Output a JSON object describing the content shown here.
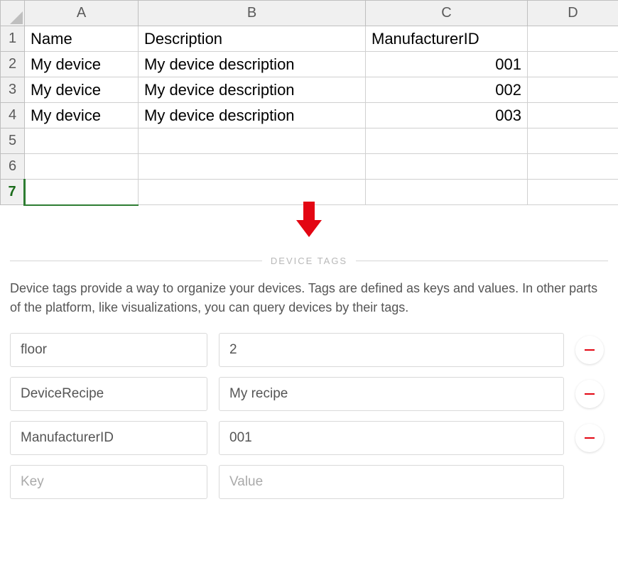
{
  "spreadsheet": {
    "columns": [
      "A",
      "B",
      "C",
      "D"
    ],
    "rows": [
      "1",
      "2",
      "3",
      "4",
      "5",
      "6",
      "7"
    ],
    "selected_row": "7",
    "data": [
      {
        "A": "Name",
        "B": "Description",
        "C": "ManufacturerID",
        "C_align": "left",
        "D": ""
      },
      {
        "A": "My device",
        "B": "My device description",
        "C": "001",
        "C_align": "right",
        "D": ""
      },
      {
        "A": "My device",
        "B": "My device description",
        "C": "002",
        "C_align": "right",
        "D": ""
      },
      {
        "A": "My device",
        "B": "My device description",
        "C": "003",
        "C_align": "right",
        "D": ""
      },
      {
        "A": "",
        "B": "",
        "C": "",
        "D": ""
      },
      {
        "A": "",
        "B": "",
        "C": "",
        "D": ""
      },
      {
        "A": "",
        "B": "",
        "C": "",
        "D": ""
      }
    ]
  },
  "tags": {
    "section_title": "DEVICE TAGS",
    "help": "Device tags provide a way to organize your devices. Tags are defined as keys and values. In other parts of the platform, like visualizations, you can query devices by their tags.",
    "rows": [
      {
        "key": "floor",
        "value": "2"
      },
      {
        "key": "DeviceRecipe",
        "value": "My recipe"
      },
      {
        "key": "ManufacturerID",
        "value": "001"
      }
    ],
    "placeholder_key": "Key",
    "placeholder_value": "Value"
  }
}
